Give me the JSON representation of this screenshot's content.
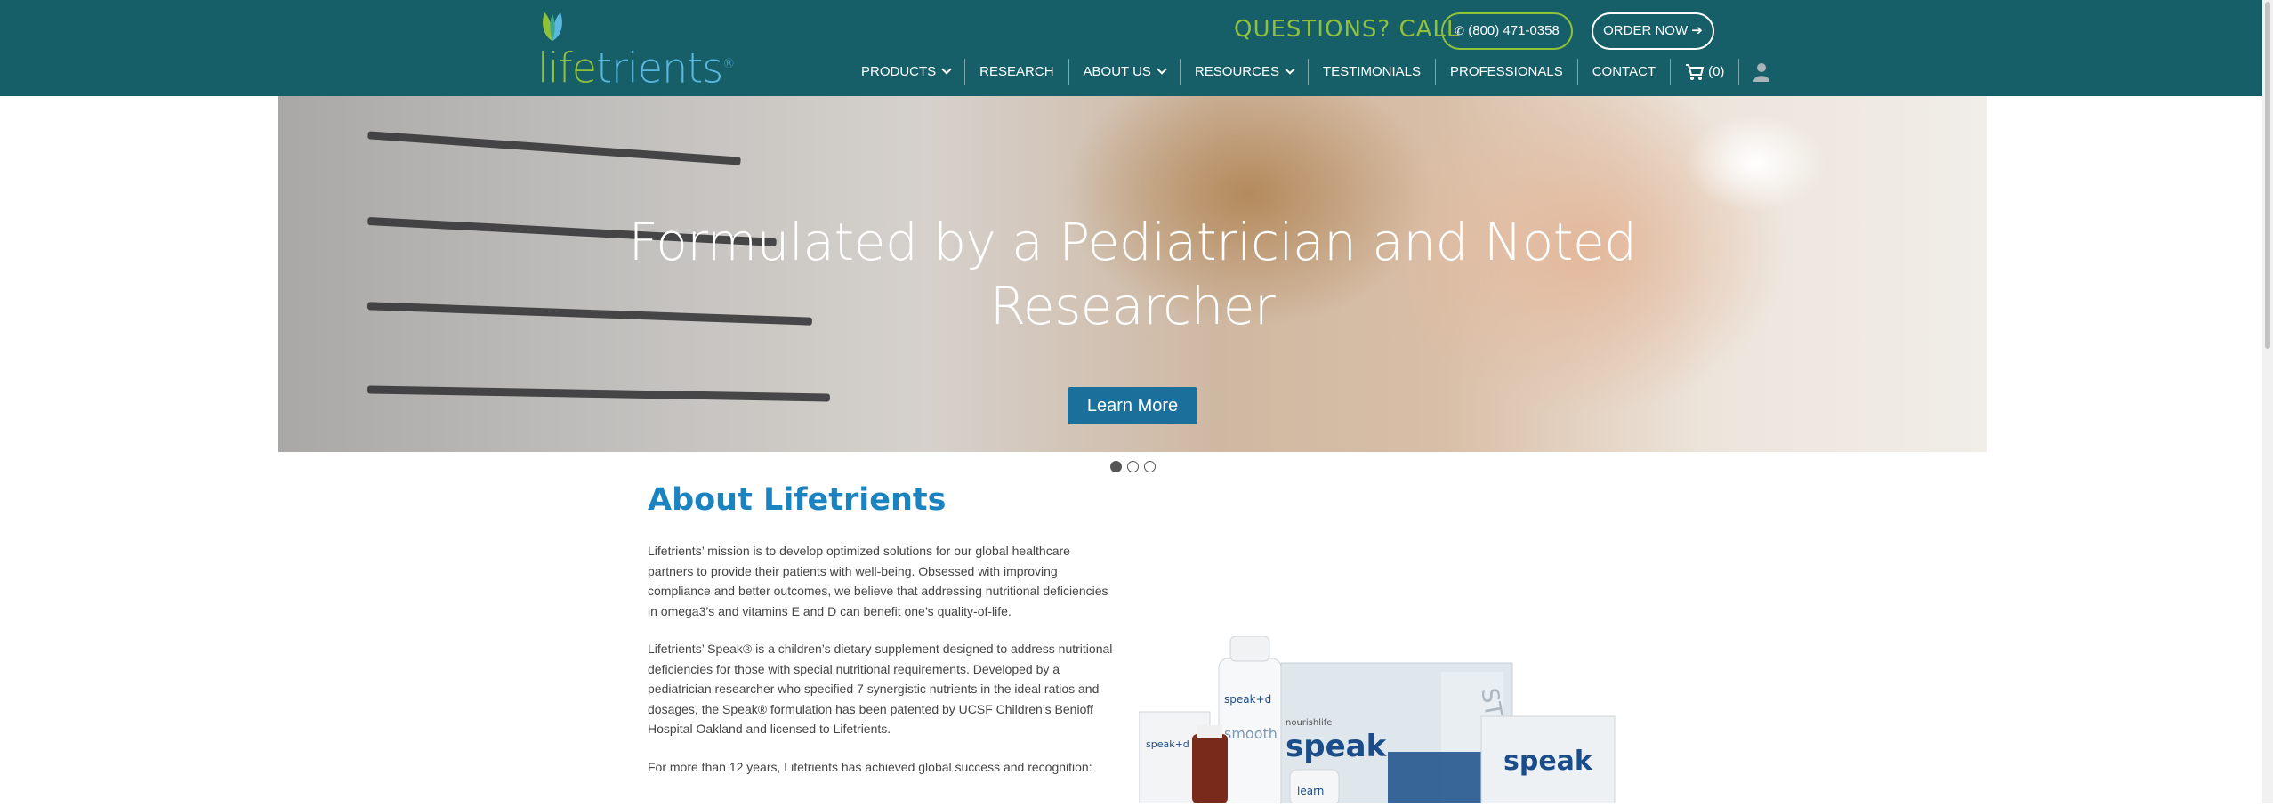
{
  "brand": {
    "logo_part1": "life",
    "logo_part2": "trients",
    "trademark": "®"
  },
  "header": {
    "questions_label": "QUESTIONS? CALL",
    "phone": "(800) 471-0358",
    "order_label": "ORDER NOW"
  },
  "nav": {
    "items": [
      {
        "label": "PRODUCTS"
      },
      {
        "label": "RESEARCH"
      },
      {
        "label": "ABOUT US"
      },
      {
        "label": "RESOURCES"
      },
      {
        "label": "TESTIMONIALS"
      },
      {
        "label": "PROFESSIONALS"
      },
      {
        "label": "CONTACT"
      }
    ],
    "cart": "(0)"
  },
  "hero": {
    "title_line1": "Formulated by a Pediatrician and Noted",
    "title_line2": "Researcher",
    "button": "Learn More",
    "slide_count": 3,
    "active_slide": 1
  },
  "about": {
    "title": "About Lifetrients",
    "p1": "Lifetrients’ mission is to develop optimized solutions for our global healthcare partners to provide their patients with well-being. Obsessed with improving compliance and better outcomes, we believe that addressing nutritional deficiencies in omega3’s and vitamins E and D can benefit one’s quality-of-life.",
    "p2": "Lifetrients’ Speak® is a children’s dietary supplement designed to address nutritional deficiencies for those with special nutritional requirements. Developed by a pediatrician researcher who specified 7 synergistic nutrients in the ideal ratios and dosages, the Speak® formulation has been patented by UCSF Children’s Benioff Hospital Oakland and licensed to Lifetrients.",
    "p3": "For more than 12 years, Lifetrients has achieved global success and recognition:"
  },
  "product_labels": {
    "brand_small": "nourishlife",
    "main": "speak",
    "smooth": "smooth",
    "speak_d": "speak+d",
    "kit": "STARTER KIT",
    "learn": "learn"
  },
  "colors": {
    "header_bg": "#165f69",
    "accent_green": "#8fc13a",
    "title_blue": "#1b84c0",
    "button_blue": "#1a6f9b"
  }
}
